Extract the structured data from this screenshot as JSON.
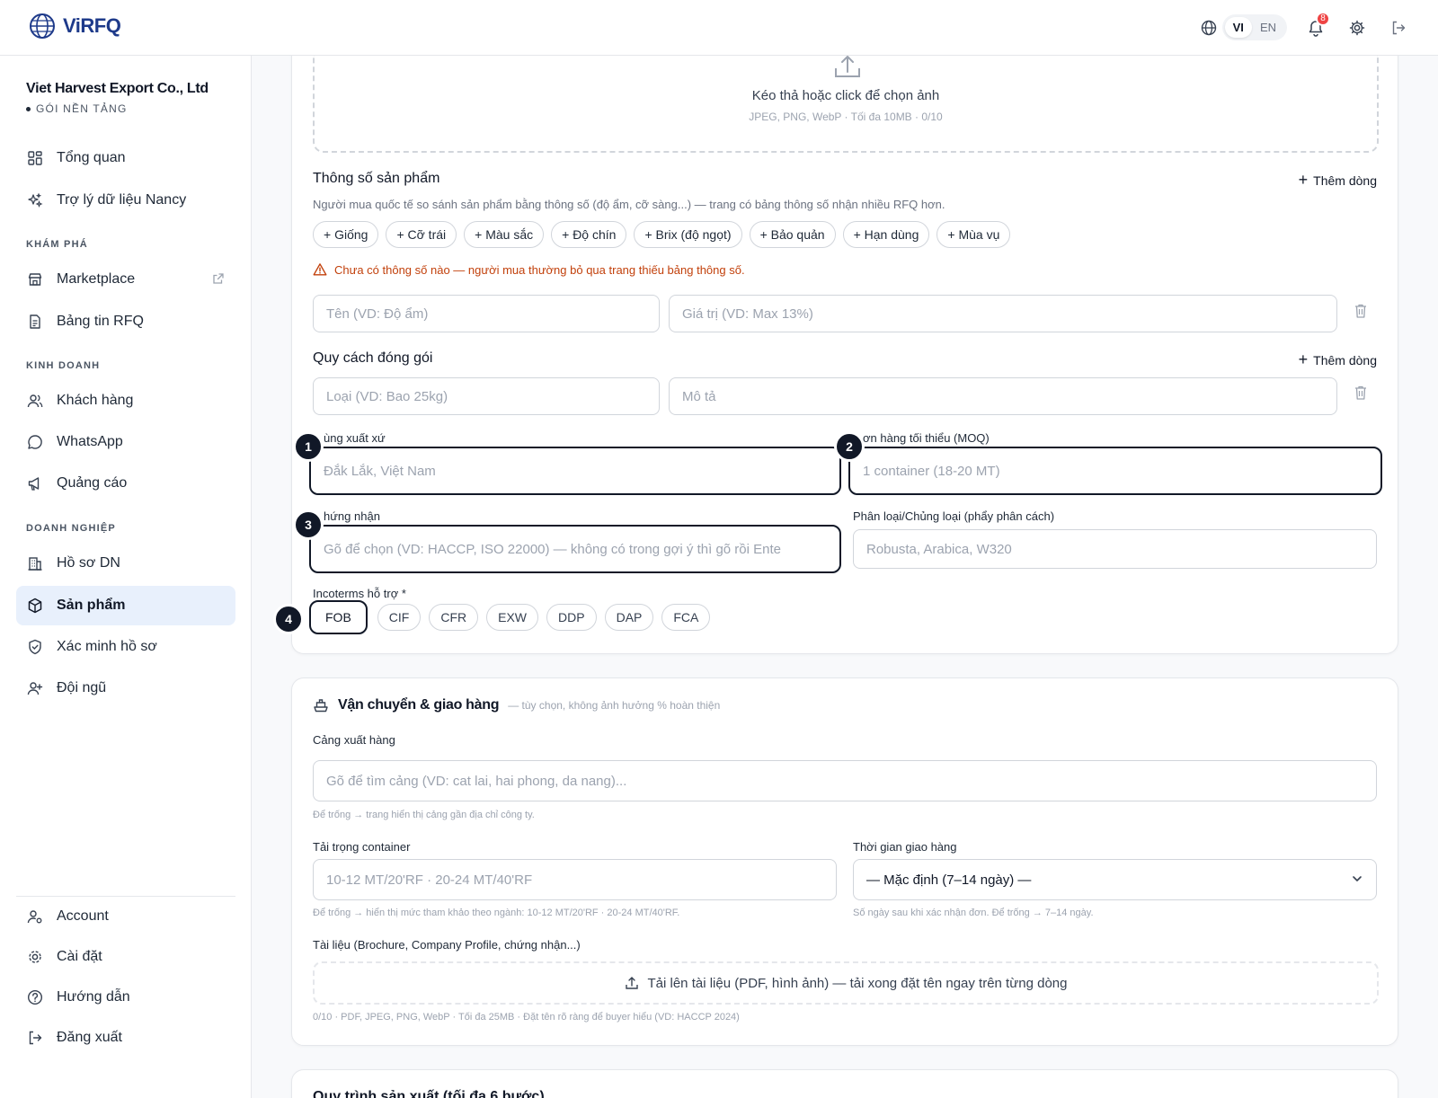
{
  "app": {
    "logo_text": "ViRFQ"
  },
  "topbar": {
    "lang_vi": "VI",
    "lang_en": "EN",
    "notif_count": "8"
  },
  "sidebar": {
    "company_name": "Viet Harvest Export Co., Ltd",
    "plan": "GÓI NỀN TẢNG",
    "items": {
      "overview": "Tổng quan",
      "assistant": "Trợ lý dữ liệu Nancy",
      "marketplace": "Marketplace",
      "rfq_board": "Bảng tin RFQ",
      "customers": "Khách hàng",
      "whatsapp": "WhatsApp",
      "ads": "Quảng cáo",
      "profile": "Hồ sơ DN",
      "products": "Sản phẩm",
      "verify": "Xác minh hồ sơ",
      "team": "Đội ngũ",
      "account": "Account",
      "settings": "Cài đặt",
      "guide": "Hướng dẫn",
      "logout": "Đăng xuất"
    },
    "sections": {
      "explore": "KHÁM PHÁ",
      "business": "KINH DOANH",
      "company": "DOANH NGHIỆP"
    }
  },
  "upload": {
    "title": "Kéo thả hoặc click để chọn ảnh",
    "sub": "JPEG, PNG, WebP · Tối đa 10MB · 0/10"
  },
  "specs": {
    "title": "Thông số sản phẩm",
    "add_row": "Thêm dòng",
    "hint": "Người mua quốc tế so sánh sản phẩm bằng thông số (độ ẩm, cỡ sàng...) — trang có bảng thông số nhận nhiều RFQ hơn.",
    "chips": [
      "+ Giống",
      "+ Cỡ trái",
      "+ Màu sắc",
      "+ Độ chín",
      "+ Brix (độ ngọt)",
      "+ Bảo quản",
      "+ Hạn dùng",
      "+ Mùa vụ"
    ],
    "warning": "Chưa có thông số nào — người mua thường bỏ qua trang thiếu bảng thông số.",
    "name_placeholder": "Tên (VD: Độ ẩm)",
    "value_placeholder": "Giá trị (VD: Max 13%)"
  },
  "packing": {
    "title": "Quy cách đóng gói",
    "add_row": "Thêm dòng",
    "type_placeholder": "Loại (VD: Bao 25kg)",
    "desc_placeholder": "Mô tả"
  },
  "origin": {
    "label": "ùng xuất xứ",
    "placeholder": "Đắk Lắk, Việt Nam"
  },
  "moq": {
    "label": "ơn hàng tối thiểu (MOQ)",
    "placeholder": "1 container (18-20 MT)"
  },
  "cert": {
    "label": "hứng nhận",
    "placeholder": "Gõ để chọn (VD: HACCP, ISO 22000) — không có trong gợi ý thì gõ rồi Ente"
  },
  "variety": {
    "label": "Phân loại/Chủng loại (phẩy phân cách)",
    "placeholder": "Robusta, Arabica, W320"
  },
  "incoterms": {
    "label": "Incoterms hỗ trợ *",
    "options": [
      "FOB",
      "CIF",
      "CFR",
      "EXW",
      "DDP",
      "DAP",
      "FCA"
    ],
    "selected": "FOB"
  },
  "callouts": [
    "1",
    "2",
    "3",
    "4"
  ],
  "shipping": {
    "title": "Vận chuyển & giao hàng",
    "sub": "— tùy chọn, không ảnh hưởng % hoàn thiện",
    "port_label": "Cảng xuất hàng",
    "port_placeholder": "Gõ để tìm cảng (VD: cat lai, hai phong, da nang)...",
    "port_hint": "Để trống → trang hiển thị cảng gần địa chỉ công ty.",
    "load_label": "Tải trọng container",
    "load_placeholder": "10-12 MT/20'RF · 20-24 MT/40'RF",
    "load_hint": "Để trống → hiển thị mức tham khảo theo ngành: 10-12 MT/20'RF · 20-24 MT/40'RF.",
    "lead_label": "Thời gian giao hàng",
    "lead_value": "— Mặc định (7–14 ngày) —",
    "lead_hint": "Số ngày sau khi xác nhận đơn. Để trống → 7–14 ngày.",
    "docs_label": "Tài liệu (Brochure, Company Profile, chứng nhận...)",
    "docs_button": "Tải lên tài liệu (PDF, hình ảnh) — tải xong đặt tên ngay trên từng dòng",
    "docs_hint": "0/10 · PDF, JPEG, PNG, WebP · Tối đa 25MB · Đặt tên rõ ràng để buyer hiểu (VD: HACCP 2024)"
  },
  "process": {
    "title": "Quy trình sản xuất (tối đa 6 bước)"
  },
  "colors": {
    "brand": "#1e3a8a",
    "active_nav": "#e8f0fc",
    "warning": "#c2410c",
    "badge": "#ef4444"
  }
}
